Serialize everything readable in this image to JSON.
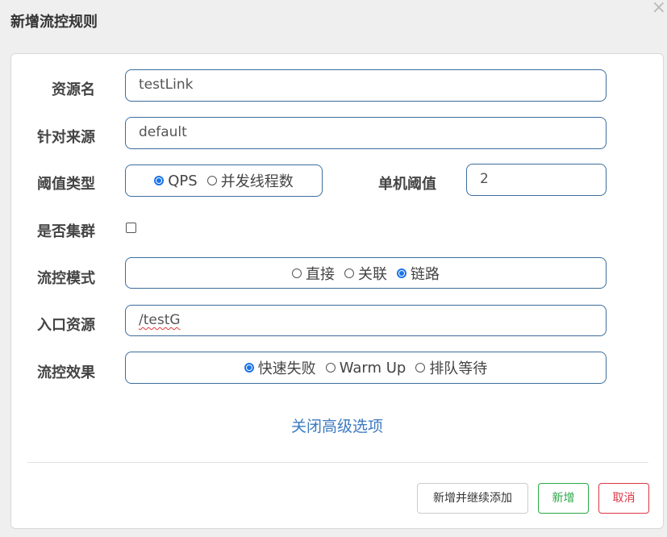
{
  "dialog": {
    "title": "新增流控规则",
    "close_symbol": "×"
  },
  "form": {
    "resource_label": "资源名",
    "resource_value": "testLink",
    "limit_app_label": "针对来源",
    "limit_app_value": "default",
    "threshold_type_label": "阈值类型",
    "threshold_type_options": [
      "QPS",
      "并发线程数"
    ],
    "threshold_type_selected": "QPS",
    "single_threshold_label": "单机阈值",
    "single_threshold_value": "2",
    "cluster_label": "是否集群",
    "cluster_checked": false,
    "strategy_label": "流控模式",
    "strategy_options": [
      "直接",
      "关联",
      "链路"
    ],
    "strategy_selected": "链路",
    "entry_resource_label": "入口资源",
    "entry_resource_value": "/testG",
    "control_behavior_label": "流控效果",
    "control_behavior_options": [
      "快速失败",
      "Warm Up",
      "排队等待"
    ],
    "control_behavior_selected": "快速失败",
    "advanced_toggle_label": "关闭高级选项"
  },
  "footer": {
    "add_continue_label": "新增并继续添加",
    "add_label": "新增",
    "cancel_label": "取消"
  },
  "colors": {
    "accent": "#1a73e8",
    "field_border": "#3c6d9c",
    "link": "#3c7ac0",
    "success": "#28a745",
    "danger": "#dc3545"
  }
}
